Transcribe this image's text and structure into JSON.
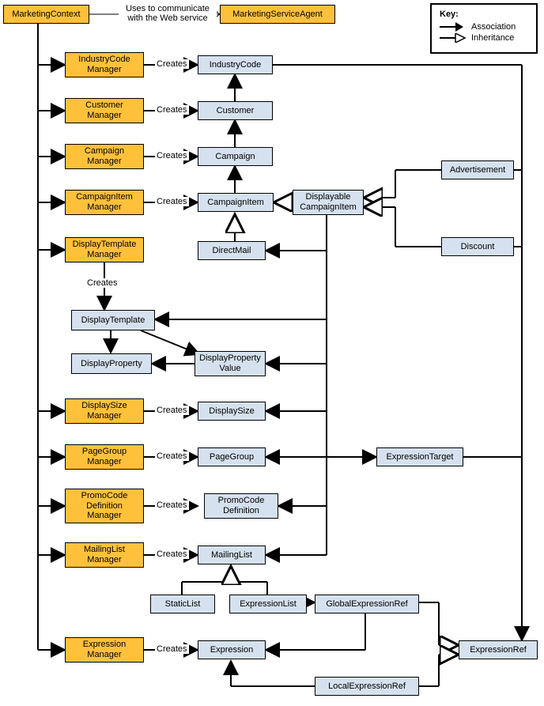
{
  "key": {
    "title": "Key:",
    "assoc": "Association",
    "inh": "Inheritance"
  },
  "labels": {
    "uses": "Uses to communicate\nwith the Web service",
    "creates": "Creates"
  },
  "nodes": {
    "MarketingContext": "MarketingContext",
    "MarketingServiceAgent": "MarketingServiceAgent",
    "IndustryCodeManager": "IndustryCode\nManager",
    "IndustryCode": "IndustryCode",
    "CustomerManager": "Customer\nManager",
    "Customer": "Customer",
    "CampaignManager": "Campaign\nManager",
    "Campaign": "Campaign",
    "CampaignItemManager": "CampaignItem\nManager",
    "CampaignItem": "CampaignItem",
    "DisplayableCampaignItem": "Displayable\nCampaignItem",
    "Advertisement": "Advertisement",
    "Discount": "Discount",
    "DirectMail": "DirectMail",
    "DisplayTemplateManager": "DisplayTemplate\nManager",
    "DisplayTemplate": "DisplayTemplate",
    "DisplayProperty": "DisplayProperty",
    "DisplayPropertyValue": "DisplayProperty\nValue",
    "DisplaySizeManager": "DisplaySize\nManager",
    "DisplaySize": "DisplaySize",
    "PageGroupManager": "PageGroup\nManager",
    "PageGroup": "PageGroup",
    "ExpressionTarget": "ExpressionTarget",
    "PromoCodeDefinitionManager": "PromoCode\nDefinition\nManager",
    "PromoCodeDefinition": "PromoCode\nDefinition",
    "MailingListManager": "MailingList\nManager",
    "MailingList": "MailingList",
    "StaticList": "StaticList",
    "ExpressionList": "ExpressionList",
    "GlobalExpressionRef": "GlobalExpressionRef",
    "ExpressionManager": "Expression\nManager",
    "Expression": "Expression",
    "LocalExpressionRef": "LocalExpressionRef",
    "ExpressionRef": "ExpressionRef"
  }
}
